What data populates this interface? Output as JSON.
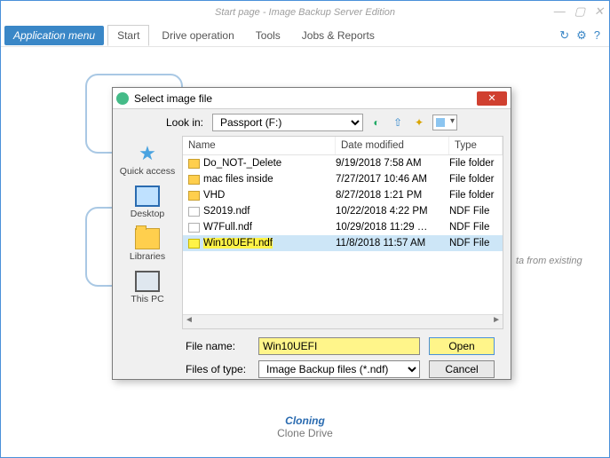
{
  "window": {
    "title": "Start page - Image Backup Server Edition",
    "controls": {
      "min": "—",
      "max": "▢",
      "close": "✕"
    }
  },
  "menubar": {
    "appmenu": "Application menu",
    "items": [
      "Start",
      "Drive operation",
      "Tools",
      "Jobs & Reports"
    ],
    "right_icons": [
      "↻",
      "⚙",
      "?"
    ]
  },
  "background": {
    "stray_text": "ta from existing"
  },
  "footer": {
    "heading": "Cloning",
    "sub": "Clone Drive"
  },
  "dialog": {
    "title": "Select image file",
    "lookin_label": "Look in:",
    "lookin_value": "Passport (F:)",
    "places": [
      {
        "label": "Quick access",
        "icon": "star"
      },
      {
        "label": "Desktop",
        "icon": "monitor"
      },
      {
        "label": "Libraries",
        "icon": "folder"
      },
      {
        "label": "This PC",
        "icon": "pc"
      }
    ],
    "columns": {
      "name": "Name",
      "date": "Date modified",
      "type": "Type"
    },
    "rows": [
      {
        "icon": "folder",
        "name": "Do_NOT-_Delete",
        "date": "9/19/2018 7:58 AM",
        "type": "File folder"
      },
      {
        "icon": "folder",
        "name": "mac files inside",
        "date": "7/27/2017 10:46 AM",
        "type": "File folder"
      },
      {
        "icon": "folder",
        "name": "VHD",
        "date": "8/27/2018 1:21 PM",
        "type": "File folder"
      },
      {
        "icon": "doc",
        "name": "S2019.ndf",
        "date": "10/22/2018 4:22 PM",
        "type": "NDF File"
      },
      {
        "icon": "doc",
        "name": "W7Full.ndf",
        "date": "10/29/2018 11:29 …",
        "type": "NDF File"
      },
      {
        "icon": "hl",
        "name": "Win10UEFI.ndf",
        "date": "11/8/2018 11:57 AM",
        "type": "NDF File",
        "selected": true
      }
    ],
    "filename_label": "File name:",
    "filename_value": "Win10UEFI",
    "filter_label": "Files of type:",
    "filter_value": "Image Backup files (*.ndf)",
    "open_btn": "Open",
    "cancel_btn": "Cancel"
  }
}
